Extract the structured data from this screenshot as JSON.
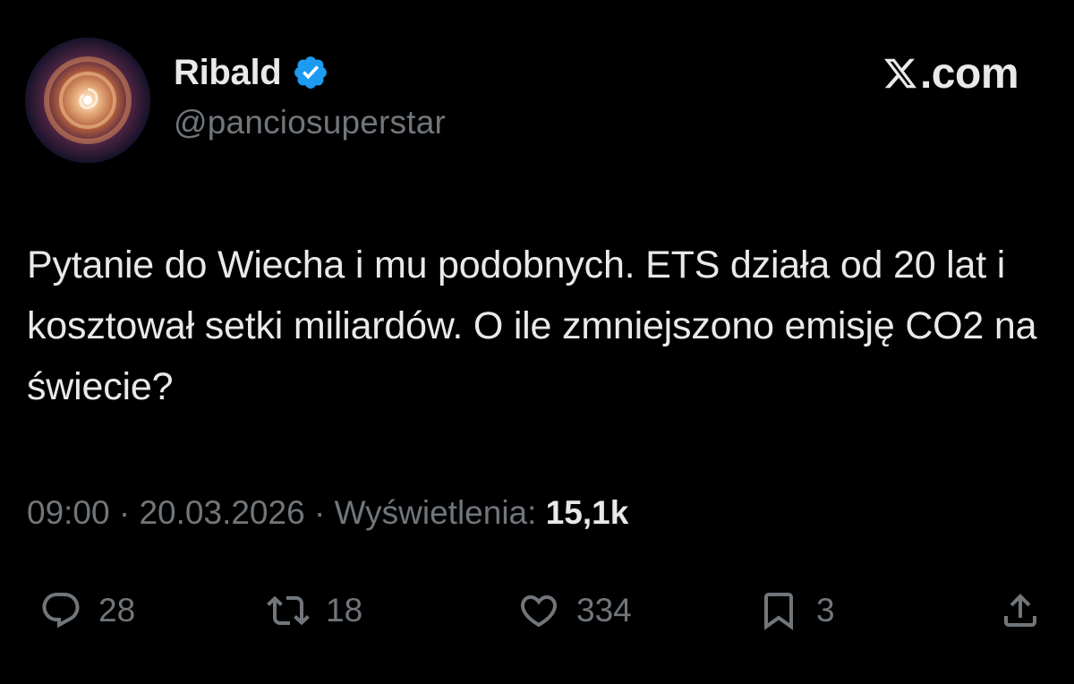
{
  "author": {
    "display_name": "Ribald",
    "handle": "@panciosuperstar",
    "verified": true,
    "avatar_icon": "nebula-avatar"
  },
  "brand": {
    "text": ".com",
    "icon": "x-logo-icon"
  },
  "tweet": {
    "text": "Pytanie do Wiecha i mu podobnych. ETS działa od 20 lat i kosztował setki miliardów. O ile zmniejszono emisję CO2 na świecie?"
  },
  "meta": {
    "time": "09:00",
    "separator": "·",
    "date": "20.03.2026",
    "views_label": "Wyświetlenia:",
    "views_count": "15,1k"
  },
  "actions": {
    "replies": "28",
    "reposts": "18",
    "likes": "334",
    "bookmarks": "3"
  },
  "colors": {
    "background": "#000000",
    "text_primary": "#e7e9ea",
    "text_secondary": "#71767b",
    "verified_blue": "#1d9bf0"
  }
}
